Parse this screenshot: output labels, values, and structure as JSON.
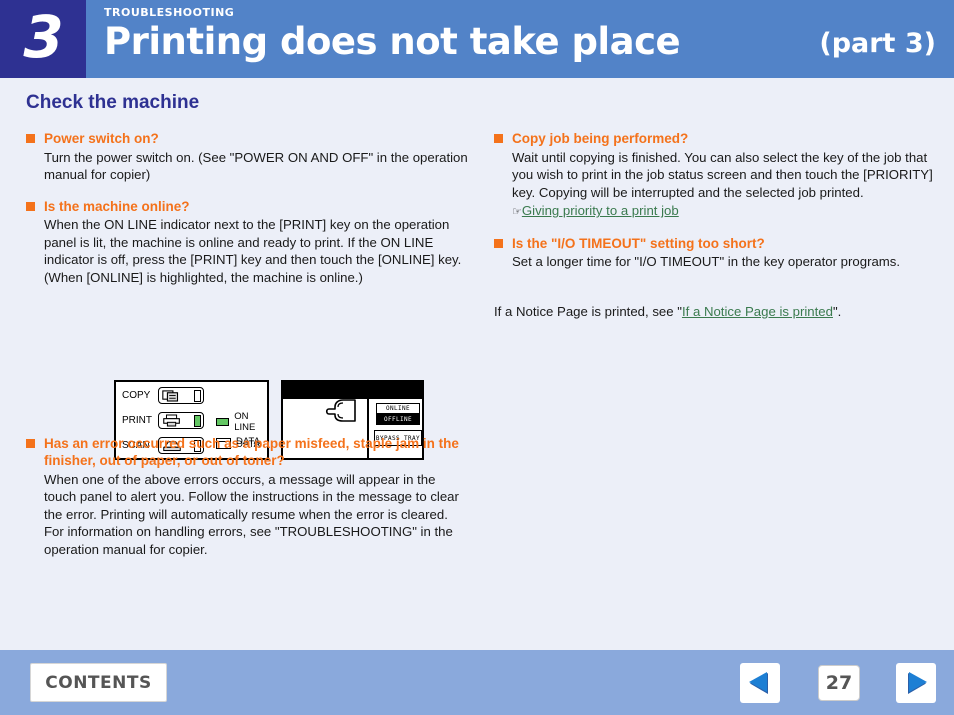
{
  "header": {
    "chapter_number": "3",
    "kicker": "TROUBLESHOOTING",
    "title": "Printing does not take place",
    "part_label": "(part 3)"
  },
  "content": {
    "section_title": "Check the machine",
    "left_column": [
      {
        "heading": "Power switch on?",
        "body": "Turn the power switch on. (See \"POWER ON AND OFF\" in the operation manual for copier)"
      },
      {
        "heading": "Is the machine online?",
        "body": "When the ON LINE indicator next to the [PRINT] key on the operation panel is lit, the machine is online and ready to print. If the ON LINE indicator is off, press the [PRINT] key and then touch the [ONLINE] key. (When [ONLINE] is highlighted, the machine is online.)"
      },
      {
        "heading": "Has an error occurred such as a paper misfeed, staple jam in the finisher, out of paper, or out of toner?",
        "body": "When one of the above errors occurs, a message will appear in the touch panel to alert you. Follow the instructions in the message to clear the error. Printing will automatically resume when the error is cleared. For information on handling errors, see \"TROUBLESHOOTING\" in the operation manual for copier."
      }
    ],
    "right_column": [
      {
        "heading": "Copy job being performed?",
        "body": "Wait until copying is finished. You can also select the key of the job that you wish to print in the job status screen and then touch the [PRIORITY] key. Copying will be interrupted and the selected job printed.",
        "link": "Giving priority to a print job",
        "link_marker": "☞"
      },
      {
        "heading": "Is the \"I/O TIMEOUT\" setting too short?",
        "body": "Set a longer time for \"I/O TIMEOUT\" in the key operator programs."
      }
    ],
    "notice": {
      "before": "If a Notice Page is printed, see \"",
      "link": "If a Notice Page is printed",
      "after": "\"."
    }
  },
  "figure": {
    "modes": [
      {
        "label": "COPY",
        "led_on": false
      },
      {
        "label": "PRINT",
        "led_on": true
      },
      {
        "label": "SCAN",
        "led_on": false
      }
    ],
    "indicators": [
      {
        "label": "ON LINE",
        "state": "on"
      },
      {
        "label": "DATA",
        "state": "off"
      },
      {
        "label": "DATA",
        "state": "off"
      }
    ],
    "touch_keys": [
      {
        "label": "ONLINE",
        "highlighted": false
      },
      {
        "label": "OFFLINE",
        "highlighted": true
      },
      {
        "label": "BYPASS TRAY",
        "highlighted": false
      }
    ]
  },
  "footer": {
    "contents_label": "CONTENTS",
    "page_number": "27",
    "prev_icon": "triangle-left-icon",
    "next_icon": "triangle-right-icon"
  },
  "colors": {
    "chapter_block": "#2e3192",
    "header_bar": "#5283c8",
    "content_bg": "#eceff8",
    "footer_bar": "#8aa9dc",
    "heading_orange": "#f4721b",
    "section_blue": "#2e3192",
    "link_green": "#3a7a4e",
    "led_green": "#63c663"
  }
}
